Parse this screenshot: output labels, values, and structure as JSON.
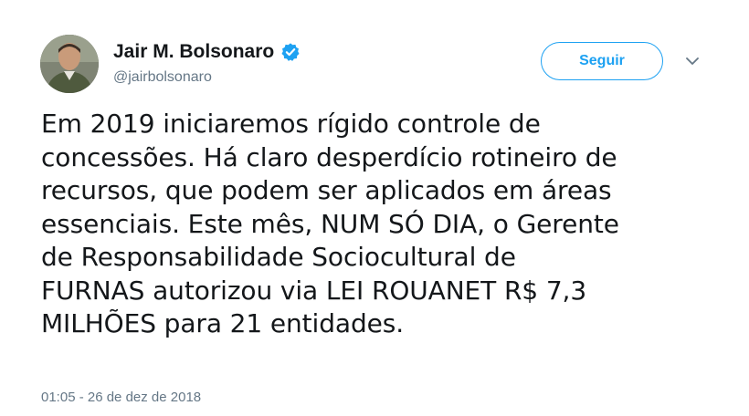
{
  "user": {
    "display_name": "Jair M. Bolsonaro",
    "handle": "@jairbolsonaro",
    "verified_icon": "verified-badge-icon",
    "avatar_icon": "profile-photo"
  },
  "actions": {
    "follow_label": "Seguir",
    "more_icon": "chevron-down-icon"
  },
  "tweet": {
    "text": "Em 2019 iniciaremos rígido controle de\nconcessões. Há claro desperdício rotineiro de\nrecursos, que podem ser aplicados em áreas\nessenciais. Este mês, NUM SÓ DIA, o Gerente\nde Responsabilidade Sociocultural de\nFURNAS autorizou via LEI ROUANET R$ 7,3\nMILHÕES para 21 entidades.",
    "timestamp": "01:05 - 26 de dez de 2018"
  },
  "colors": {
    "accent": "#1da1f2",
    "secondary_text": "#657786",
    "primary_text": "#14171a"
  }
}
